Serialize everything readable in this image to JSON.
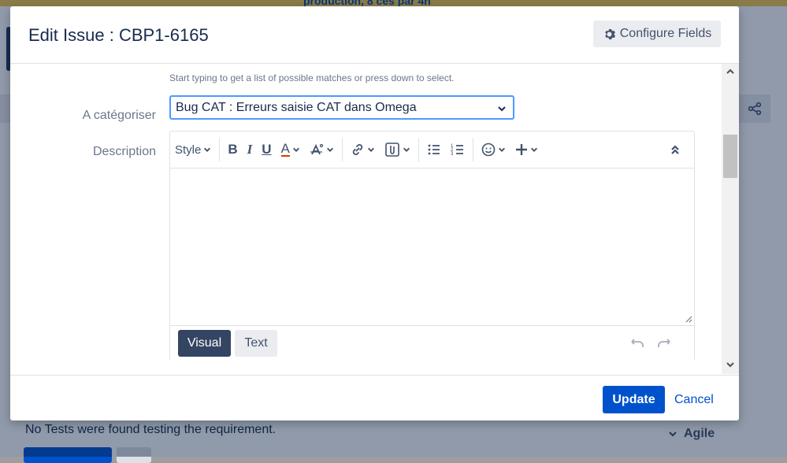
{
  "background": {
    "top_text": "production, 8 ces par 4h",
    "tests_message": "No Tests were found testing the requirement.",
    "agile_label": "Agile"
  },
  "dialog": {
    "title": "Edit Issue : CBP1-6165",
    "configure_label": "Configure Fields",
    "hint": "Start typing to get a list of possible matches or press down to select.",
    "categoriser_label": "A catégoriser",
    "categoriser_value": "Bug CAT : Erreurs saisie CAT dans Omega",
    "description_label": "Description",
    "toolbar": {
      "style_label": "Style",
      "bold": "B",
      "italic": "I",
      "underline": "U",
      "text_color": "A"
    },
    "modes": {
      "visual": "Visual",
      "text": "Text"
    },
    "update_label": "Update",
    "cancel_label": "Cancel"
  },
  "colors": {
    "primary": "#0052cc",
    "focus": "#4c9aff",
    "visual_active": "#344563",
    "text_color_underline": "#de350b"
  },
  "icons": [
    "gear-icon",
    "chevron-down-icon",
    "text-effects-icon",
    "link-icon",
    "attachment-icon",
    "bullet-list-icon",
    "numbered-list-icon",
    "emoji-icon",
    "plus-icon",
    "collapse-icon",
    "undo-icon",
    "redo-icon",
    "resize-icon",
    "share-icon",
    "scroll-up-icon",
    "scroll-down-icon"
  ]
}
